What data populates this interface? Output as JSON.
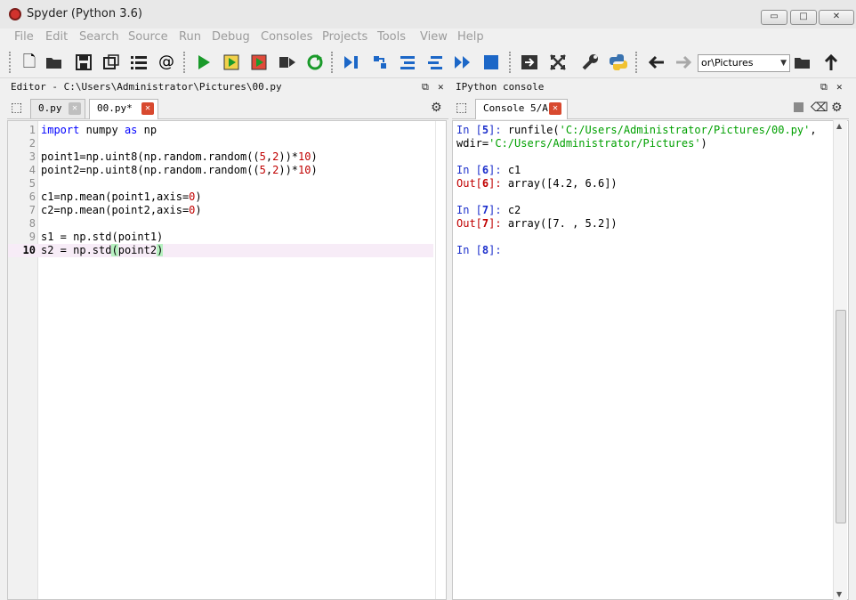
{
  "window": {
    "title": "Spyder (Python 3.6)",
    "minimize": "▭",
    "maximize": "□",
    "close": "✕"
  },
  "menu": [
    "File",
    "Edit",
    "Search",
    "Source",
    "Run",
    "Debug",
    "Consoles",
    "Projects",
    "Tools",
    "View",
    "Help"
  ],
  "toolbar": {
    "path_value": "or\\Pictures"
  },
  "editor": {
    "header": "Editor - C:\\Users\\Administrator\\Pictures\\00.py",
    "tabs": [
      {
        "label": "0.py",
        "close": "✕"
      },
      {
        "label": "00.py*",
        "close": "✕"
      }
    ],
    "lines": [
      {
        "n": "1",
        "code": "import numpy as np"
      },
      {
        "n": "2",
        "code": ""
      },
      {
        "n": "3",
        "code": "point1=np.uint8(np.random.random((5,2))*10)"
      },
      {
        "n": "4",
        "code": "point2=np.uint8(np.random.random((5,2))*10)"
      },
      {
        "n": "5",
        "code": ""
      },
      {
        "n": "6",
        "code": "c1=np.mean(point1,axis=0)"
      },
      {
        "n": "7",
        "code": "c2=np.mean(point2,axis=0)"
      },
      {
        "n": "8",
        "code": ""
      },
      {
        "n": "9",
        "code": "s1 = np.std(point1)"
      },
      {
        "n": "10",
        "code": "s2 = np.std(point2)"
      }
    ]
  },
  "console": {
    "header": "IPython console",
    "tab": "Console 5/A",
    "tab_close": "✕",
    "lines": [
      "In [5]: runfile('C:/Users/Administrator/Pictures/00.py',",
      "wdir='C:/Users/Administrator/Pictures')",
      "In [6]: c1",
      "Out[6]: array([4.2, 6.6])",
      "In [7]: c2",
      "Out[7]: array([7. , 5.2])",
      "In [8]:"
    ]
  },
  "colors": {
    "keyword": "#0000ff",
    "number": "#c00000",
    "string": "#00a000",
    "prompt_in": "#1c2fcc",
    "prompt_out": "#c00000",
    "run_green": "#1a9a2a",
    "tool_blue": "#1c67c7"
  }
}
